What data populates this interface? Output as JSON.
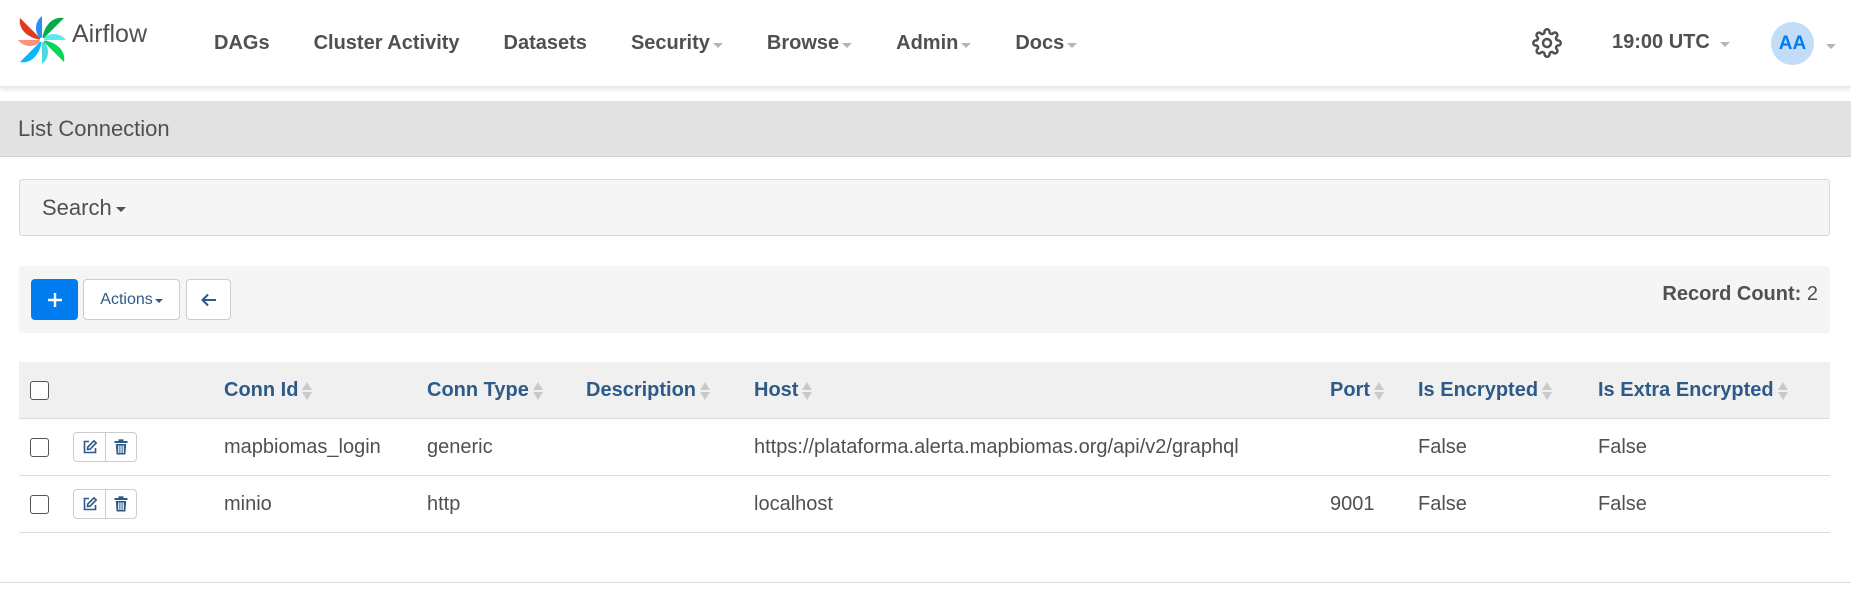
{
  "brand": {
    "name": "Airflow"
  },
  "nav": {
    "items": [
      {
        "label": "DAGs",
        "dropdown": false
      },
      {
        "label": "Cluster Activity",
        "dropdown": false
      },
      {
        "label": "Datasets",
        "dropdown": false
      },
      {
        "label": "Security",
        "dropdown": true
      },
      {
        "label": "Browse",
        "dropdown": true
      },
      {
        "label": "Admin",
        "dropdown": true
      },
      {
        "label": "Docs",
        "dropdown": true
      }
    ],
    "time": "19:00 UTC",
    "user_initials": "AA",
    "settings_icon": "gear-icon"
  },
  "page": {
    "title": "List Connection"
  },
  "search": {
    "label": "Search"
  },
  "toolbar": {
    "add_icon": "plus-icon",
    "actions_label": "Actions",
    "back_icon": "arrow-left-icon",
    "record_count_label": "Record Count:",
    "record_count_value": "2"
  },
  "table": {
    "columns": [
      "Conn Id",
      "Conn Type",
      "Description",
      "Host",
      "Port",
      "Is Encrypted",
      "Is Extra Encrypted"
    ],
    "rows": [
      {
        "conn_id": "mapbiomas_login",
        "conn_type": "generic",
        "description": "",
        "host": "https://plataforma.alerta.mapbiomas.org/api/v2/graphql",
        "port": "",
        "is_encrypted": "False",
        "is_extra_encrypted": "False"
      },
      {
        "conn_id": "minio",
        "conn_type": "http",
        "description": "",
        "host": "localhost",
        "port": "9001",
        "is_encrypted": "False",
        "is_extra_encrypted": "False"
      }
    ]
  },
  "colors": {
    "accent": "#017cee",
    "link": "#2d5a89",
    "text": "#51504f",
    "header_bg": "#e2e2e2"
  }
}
